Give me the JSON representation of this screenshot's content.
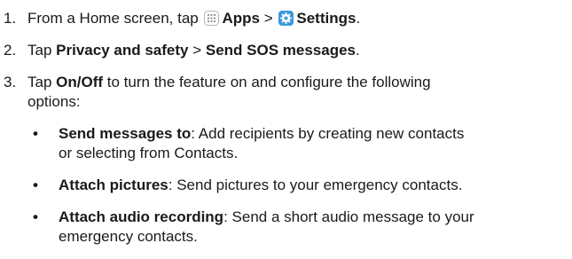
{
  "steps": [
    {
      "number": "1.",
      "pre": "From a Home screen, tap",
      "icon1": "apps-icon",
      "bold1": "Apps",
      "sep": ">",
      "icon2": "settings-icon",
      "bold2": "Settings",
      "post": "."
    },
    {
      "number": "2.",
      "pre": "Tap",
      "bold1": "Privacy and safety",
      "sep": ">",
      "bold2": "Send SOS messages",
      "post": "."
    },
    {
      "number": "3.",
      "pre": "Tap",
      "bold1": "On/Off",
      "line1_rest": "to turn the feature on and configure the following",
      "line2": "options:"
    }
  ],
  "bullets": [
    {
      "bold": "Send messages to",
      "line1_rest": ": Add recipients by creating new contacts",
      "line2": "or selecting from Contacts."
    },
    {
      "bold": "Attach pictures",
      "line1_rest": ": Send pictures to your emergency contacts."
    },
    {
      "bold": "Attach audio recording",
      "line1_rest": ": Send a short audio message to your",
      "line2": "emergency contacts."
    }
  ],
  "bullet_glyph": "•",
  "colors": {
    "text": "#1a1a1a",
    "settings_icon_bg": "#3a9ad9",
    "apps_icon": "#9a9a9a"
  }
}
